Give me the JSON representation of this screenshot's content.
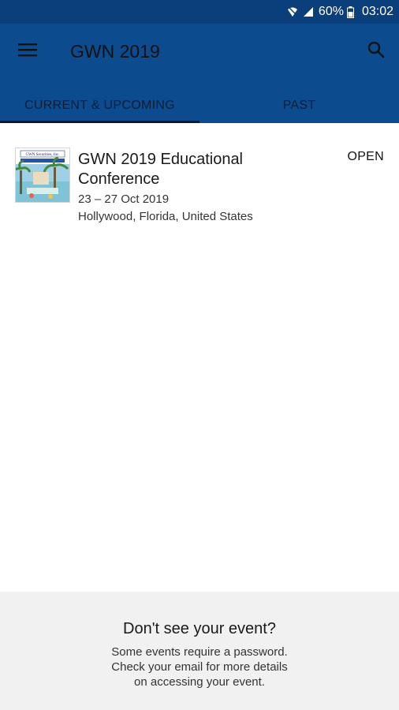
{
  "status_bar": {
    "battery_percent": "60%",
    "time": "03:02",
    "icons": [
      "wifi-icon",
      "signal-icon",
      "battery-icon"
    ]
  },
  "app_bar": {
    "title": "GWN 2019",
    "menu_icon": "hamburger-menu-icon",
    "search_icon": "search-icon",
    "colors": {
      "background": "#0c4b8e",
      "status_bar": "#0b3f7c"
    }
  },
  "tabs": [
    {
      "label": "CURRENT & UPCOMING",
      "selected": true
    },
    {
      "label": "PAST",
      "selected": false
    }
  ],
  "events": [
    {
      "title": "GWN 2019 Educational Conference",
      "dates": "23 – 27 Oct 2019",
      "location": "Hollywood, Florida, United States",
      "status": "OPEN",
      "thumbnail_text": "GWN Securities, Inc."
    }
  ],
  "footer": {
    "heading": "Don't see your event?",
    "lines": [
      "Some events require a password.",
      "Check your email for more details",
      "on accessing your event."
    ]
  }
}
